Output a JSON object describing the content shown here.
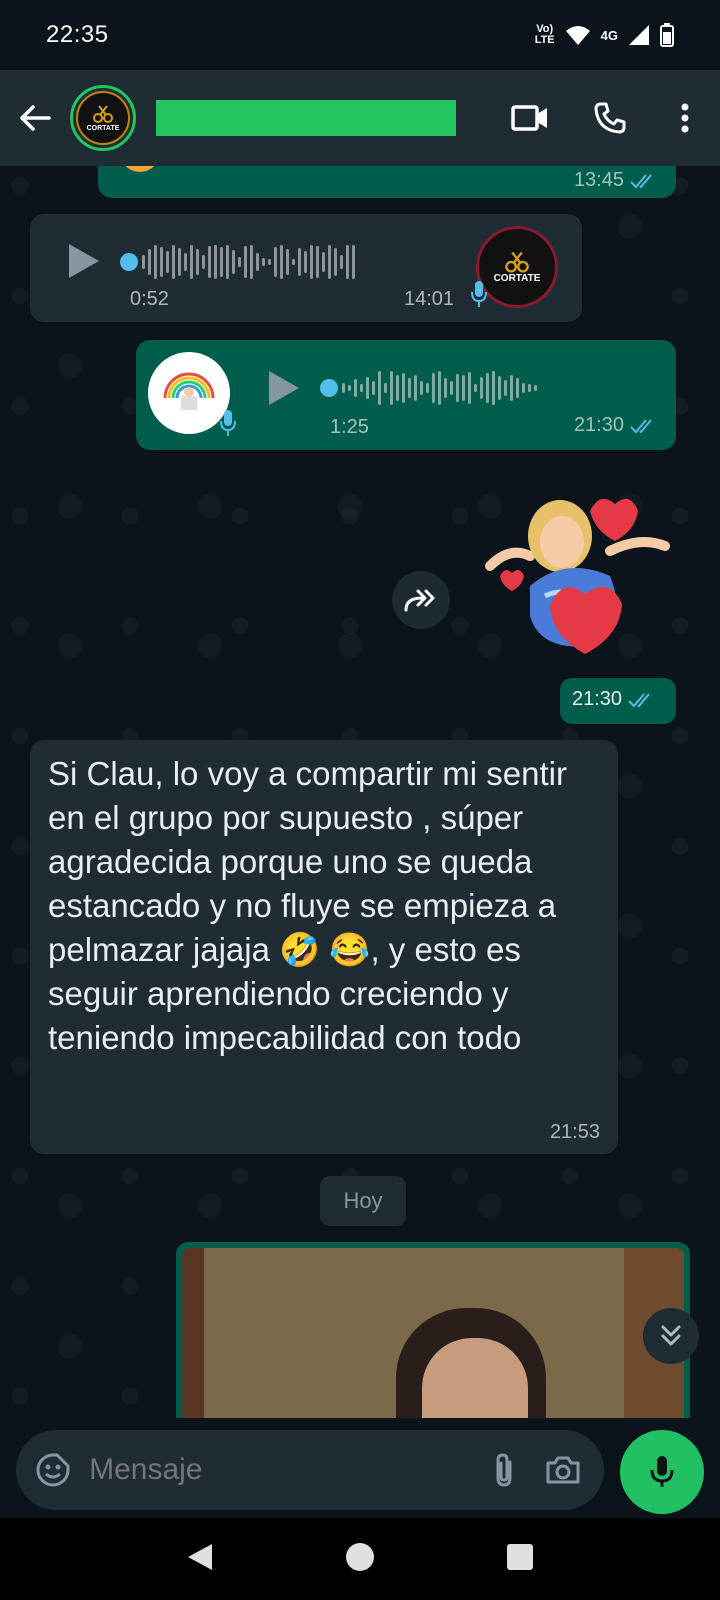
{
  "status_bar": {
    "time": "22:35",
    "volte": "Vo)\nLTE",
    "network": "4G"
  },
  "header": {
    "contact_name": "",
    "avatar_label": "CORTATE"
  },
  "messages": {
    "partial_top": {
      "time": "13:45"
    },
    "voice_in": {
      "duration": "0:52",
      "time": "14:01",
      "avatar_label": "CORTATE"
    },
    "voice_out": {
      "duration": "1:25",
      "time": "21:30"
    },
    "sticker_out": {
      "time": "21:30"
    },
    "text_in": {
      "text": "Si Clau, lo voy a compartir mi sentir en el grupo por supuesto , súper agradecida porque uno se queda estancado y no fluye se empieza a pelmazar jajaja 🤣 😂, y esto es seguir aprendiendo creciendo y teniendo impecabilidad con todo",
      "time": "21:53"
    },
    "date_chip": "Hoy"
  },
  "input": {
    "placeholder": "Mensaje"
  },
  "colors": {
    "accent": "#21c063",
    "bubble_out": "#005c4b",
    "bubble_in": "#1f2c34",
    "tick": "#53bdeb"
  },
  "icons": [
    "back-arrow-icon",
    "video-call-icon",
    "phone-icon",
    "more-vert-icon",
    "play-icon",
    "mic-icon",
    "forward-icon",
    "chevron-double-down-icon",
    "sticker-icon",
    "attach-icon",
    "camera-icon",
    "nav-back-icon",
    "nav-home-icon",
    "nav-recents-icon"
  ]
}
